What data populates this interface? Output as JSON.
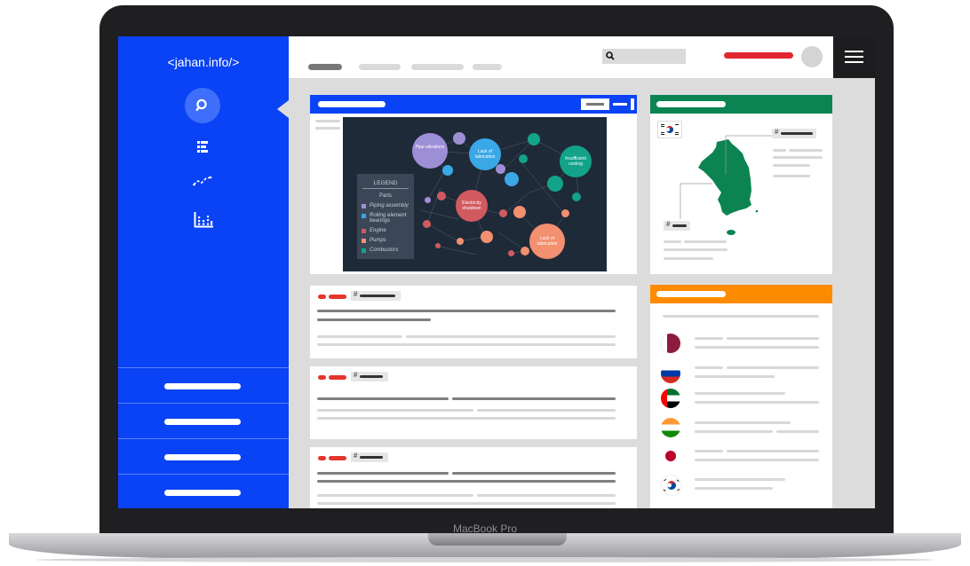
{
  "brand": {
    "logo_text": "<jahan.info/>"
  },
  "device": {
    "model_label": "MacBook Pro"
  },
  "icons": {
    "search": "search-icon",
    "list": "list-icon",
    "trend": "trend-line-icon",
    "bar_chart": "bar-chart-icon",
    "menu": "hamburger-menu-icon"
  },
  "colors": {
    "sidebar": "#0a43f5",
    "accent_green": "#0b8451",
    "accent_orange": "#ff8c00",
    "alert_red": "#e0262e",
    "network_bg": "#1f2a38"
  },
  "network": {
    "legend_title": "LEGEND",
    "legend_subtitle": "Parts",
    "legend_items": [
      {
        "label": "Piping assembly",
        "color": "#9d8fd6"
      },
      {
        "label": "Rolling element bearings",
        "color": "#3aa8e6"
      },
      {
        "label": "Engine",
        "color": "#d05a60"
      },
      {
        "label": "Pumps",
        "color": "#f29070"
      },
      {
        "label": "Combustors",
        "color": "#12a38a"
      }
    ],
    "labels": {
      "pipe_vibrations": "Pipe vibrations",
      "lack_lub_1": "Lack of lubrication",
      "insufficient_cooling": "Insufficient cooling",
      "electricity_shutdown": "Electricity shutdown",
      "lack_lub_2": "Lack of lubrication"
    }
  },
  "map": {
    "tag_symbol_1": "#",
    "tag_symbol_2": "#"
  },
  "feed": {
    "hash_1": "#",
    "hash_2": "#",
    "hash_3": "#",
    "hash_4": "#"
  },
  "countries": [
    "Qatar",
    "Russia",
    "United Arab Emirates",
    "India",
    "Japan",
    "South Korea"
  ]
}
